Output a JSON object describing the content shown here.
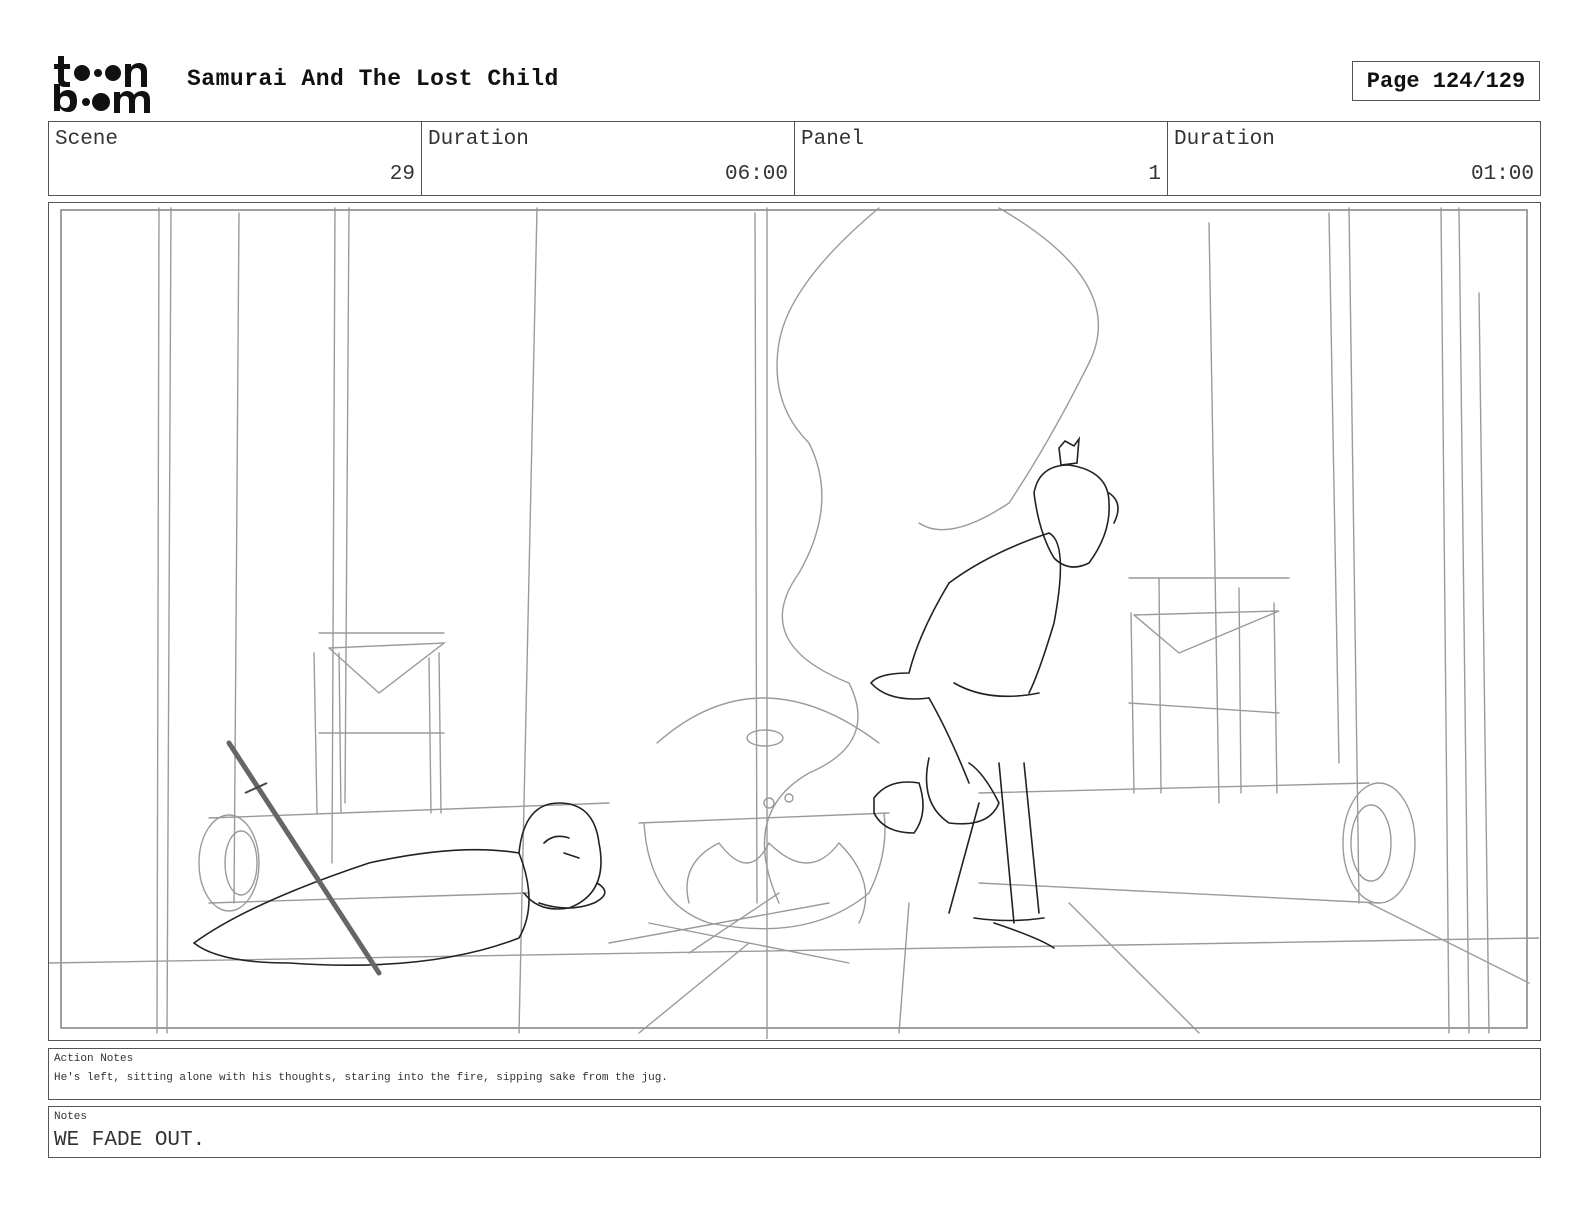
{
  "header": {
    "logo_text": "toon boom",
    "title": "Samurai And The Lost Child",
    "page": "Page 124/129"
  },
  "info": {
    "scene_label": "Scene",
    "scene_value": "29",
    "scene_duration_label": "Duration",
    "scene_duration_value": "06:00",
    "panel_label": "Panel",
    "panel_value": "1",
    "panel_duration_label": "Duration",
    "panel_duration_value": "01:00"
  },
  "action_notes": {
    "label": "Action Notes",
    "text": "He's left, sitting alone with his thoughts, staring into the fire, sipping sake from the jug."
  },
  "notes": {
    "label": "Notes",
    "text": "WE FADE OUT."
  }
}
